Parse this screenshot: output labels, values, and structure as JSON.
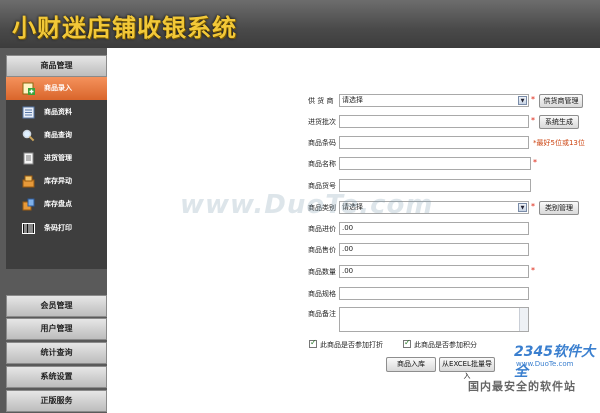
{
  "app": {
    "title": "小财迷店铺收银系统"
  },
  "sidebar": {
    "section_title": "商品管理",
    "items": [
      {
        "label": "商品录入",
        "icon": "add-product-icon",
        "active": true
      },
      {
        "label": "商品资料",
        "icon": "product-list-icon",
        "active": false
      },
      {
        "label": "商品查询",
        "icon": "search-icon",
        "active": false
      },
      {
        "label": "进货管理",
        "icon": "document-icon",
        "active": false
      },
      {
        "label": "库存异动",
        "icon": "inventory-move-icon",
        "active": false
      },
      {
        "label": "库存盘点",
        "icon": "inventory-check-icon",
        "active": false
      },
      {
        "label": "条码打印",
        "icon": "barcode-icon",
        "active": false
      }
    ],
    "bottom": [
      "会员管理",
      "用户管理",
      "统计查询",
      "系统设置",
      "正版服务"
    ]
  },
  "form": {
    "supplier_label": "供 货 商",
    "supplier_value": "请选择",
    "supplier_button": "供货商管理",
    "batch_label": "进货批次",
    "batch_value": "",
    "batch_button": "系统生成",
    "barcode_label": "商品条码",
    "barcode_value": "",
    "barcode_hint": "*最好5位或13位",
    "name_label": "商品名称",
    "name_value": "",
    "code_label": "商品货号",
    "code_value": "",
    "category_label": "商品类别",
    "category_value": "请选择",
    "category_button": "类别管理",
    "cost_label": "商品进价",
    "cost_value": ".00",
    "price_label": "商品售价",
    "price_value": ".00",
    "qty_label": "商品数量",
    "qty_value": ".00",
    "spec_label": "商品规格",
    "spec_value": "",
    "note_label": "商品备注",
    "required_mark": "*",
    "checkbox_discount": "此商品是否参加打折",
    "checkbox_points": "此商品是否参加积分",
    "save_button": "商品入库",
    "import_button": "从EXCEL批量导入"
  },
  "watermarks": {
    "center": "www.DuoTe.com",
    "logo": "2345软件大全",
    "url": "www.DuoTe.com",
    "tagline": "国内最安全的软件站"
  }
}
